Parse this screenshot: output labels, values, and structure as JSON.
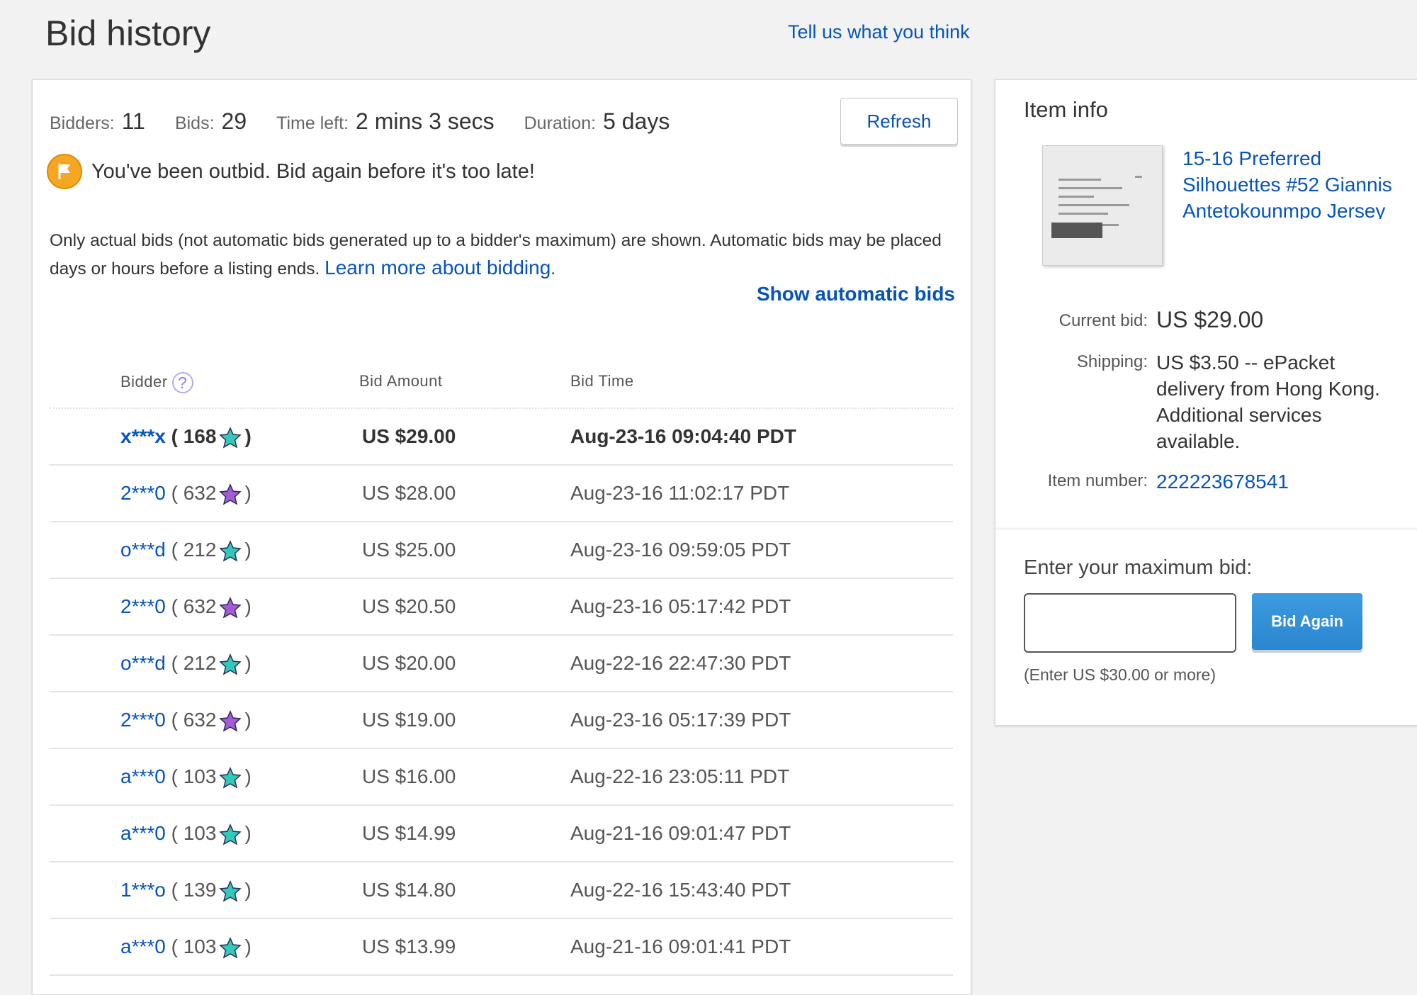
{
  "header": {
    "title": "Bid history",
    "feedback_link": "Tell us what you think"
  },
  "summary": {
    "bidders_label": "Bidders:",
    "bidders_value": "11",
    "bids_label": "Bids:",
    "bids_value": "29",
    "time_left_label": "Time left:",
    "time_left_value": "2 mins 3 secs",
    "duration_label": "Duration:",
    "duration_value": "5 days",
    "refresh_label": "Refresh"
  },
  "alert": {
    "icon": "flag-icon",
    "text": "You've been outbid. Bid again before it's too late!",
    "color": "#f5a623"
  },
  "info": {
    "text": "Only actual bids (not automatic bids generated up to a bidder's maximum) are shown. Automatic bids may be placed days or hours before a listing ends.",
    "link": "Learn more about bidding",
    "period": ".",
    "show_automatic": "Show automatic bids"
  },
  "table": {
    "headers": {
      "bidder": "Bidder",
      "help": "?",
      "amount": "Bid Amount",
      "time": "Bid Time"
    },
    "rows": [
      {
        "bidder": "x***x",
        "score": "168",
        "star": "turquoise",
        "amount": "US $29.00",
        "time": "Aug-23-16 09:04:40 PDT"
      },
      {
        "bidder": "2***0",
        "score": "632",
        "star": "purple",
        "amount": "US $28.00",
        "time": "Aug-23-16 11:02:17 PDT"
      },
      {
        "bidder": "o***d",
        "score": "212",
        "star": "turquoise",
        "amount": "US $25.00",
        "time": "Aug-23-16 09:59:05 PDT"
      },
      {
        "bidder": "2***0",
        "score": "632",
        "star": "purple",
        "amount": "US $20.50",
        "time": "Aug-23-16 05:17:42 PDT"
      },
      {
        "bidder": "o***d",
        "score": "212",
        "star": "turquoise",
        "amount": "US $20.00",
        "time": "Aug-22-16 22:47:30 PDT"
      },
      {
        "bidder": "2***0",
        "score": "632",
        "star": "purple",
        "amount": "US $19.00",
        "time": "Aug-23-16 05:17:39 PDT"
      },
      {
        "bidder": "a***0",
        "score": "103",
        "star": "turquoise",
        "amount": "US $16.00",
        "time": "Aug-22-16 23:05:11 PDT"
      },
      {
        "bidder": "a***0",
        "score": "103",
        "star": "turquoise",
        "amount": "US $14.99",
        "time": "Aug-21-16 09:01:47 PDT"
      },
      {
        "bidder": "1***o",
        "score": "139",
        "star": "turquoise",
        "amount": "US $14.80",
        "time": "Aug-22-16 15:43:40 PDT"
      },
      {
        "bidder": "a***0",
        "score": "103",
        "star": "turquoise",
        "amount": "US $13.99",
        "time": "Aug-21-16 09:01:41 PDT"
      }
    ]
  },
  "item": {
    "title_label": "Item info",
    "name": "15-16 Preferred Silhouettes #52 Giannis Antetokounmpo Jersey",
    "current_bid_label": "Current bid:",
    "current_bid": "US $29.00",
    "shipping_label": "Shipping:",
    "shipping": "US $3.50 -- ePacket delivery from Hong Kong.  Additional services available.",
    "item_number_label": "Item number:",
    "item_number": "222223678541"
  },
  "bid_form": {
    "label": "Enter your maximum bid:",
    "input_value": "",
    "button_label": "Bid Again",
    "hint": "(Enter US $30.00 or more)"
  },
  "colors": {
    "link": "#0654ba",
    "star_turquoise": "#33c9b8",
    "star_purple": "#a35bd6",
    "button": "#2a86cf"
  }
}
